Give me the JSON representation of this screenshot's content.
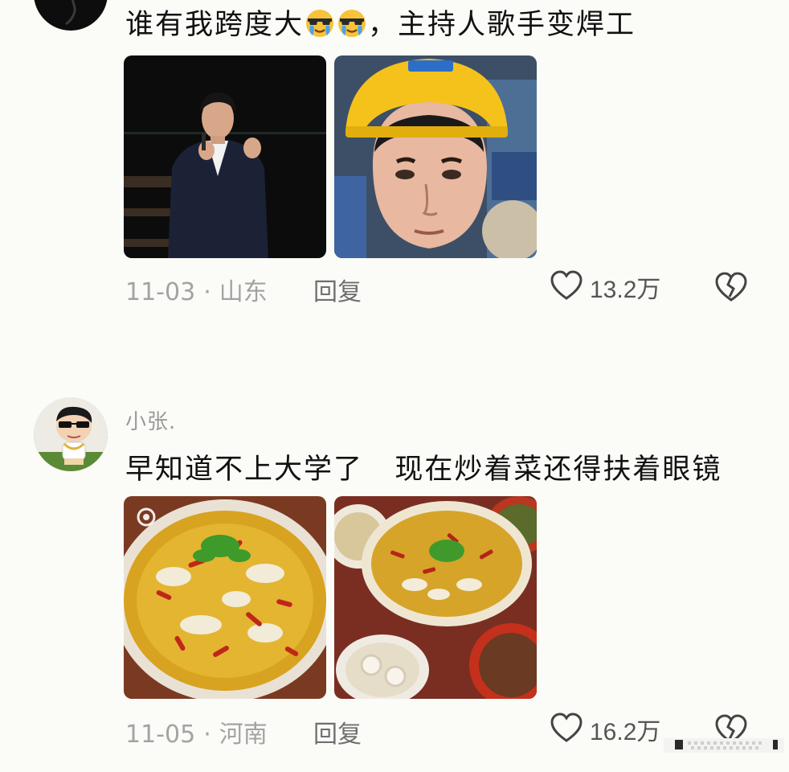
{
  "comments": [
    {
      "username": "",
      "text_before": "谁有我跨度大",
      "emoji": "sunglasses-crying-emoji",
      "text_after": "，主持人歌手变焊工",
      "date": "11-03",
      "location": "山东",
      "reply_label": "回复",
      "likes": "13.2万"
    },
    {
      "username": "小张.",
      "text": "早知道不上大学了   现在炒着菜还得扶着眼镜",
      "date": "11-05",
      "location": "河南",
      "reply_label": "回复",
      "likes": "16.2万"
    }
  ],
  "separator": "·",
  "icons": {
    "like": "heart-outline-icon",
    "dislike": "broken-heart-icon"
  },
  "colors": {
    "background": "#fbfbf8",
    "meta": "#a3a3a3",
    "reply": "#6f6f6f"
  }
}
